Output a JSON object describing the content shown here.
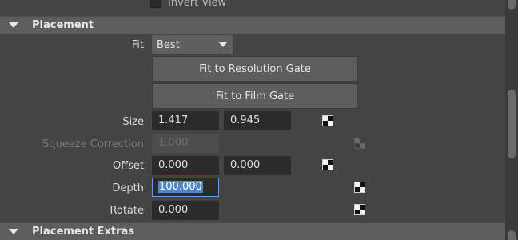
{
  "top": {
    "invert_view_label": "Invert View"
  },
  "placement": {
    "title": "Placement",
    "fit_label": "Fit",
    "fit_value": "Best",
    "fit_resolution_button": "Fit to Resolution Gate",
    "fit_film_button": "Fit to Film Gate",
    "size_label": "Size",
    "size_x": "1.417",
    "size_y": "0.945",
    "squeeze_label": "Squeeze Correction",
    "squeeze_value": "1.000",
    "offset_label": "Offset",
    "offset_x": "0.000",
    "offset_y": "0.000",
    "depth_label": "Depth",
    "depth_value": "100.000",
    "rotate_label": "Rotate",
    "rotate_value": "0.000"
  },
  "placement_extras": {
    "title": "Placement Extras"
  },
  "icons": {
    "map_button": "checker-map-icon",
    "section_toggle": "triangle-down-icon",
    "dropdown_arrow": "chevron-down-icon"
  },
  "colors": {
    "background": "#444444",
    "section_header": "#5d5d5d",
    "field": "#2b2b2b",
    "selection": "#5285c6"
  }
}
